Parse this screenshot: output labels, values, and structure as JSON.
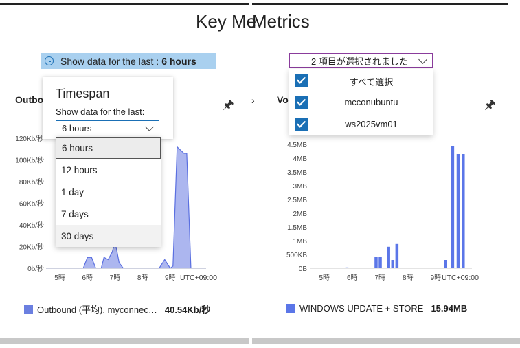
{
  "page_title_left": "Key Me",
  "page_title_right": "Metrics",
  "left": {
    "timebar": {
      "prefix": "Show data for the last :",
      "value": "6 hours"
    },
    "chart_title_partial": "Outbo",
    "popup": {
      "title": "Timespan",
      "label": "Show data for the last:",
      "selected": "6 hours",
      "options": [
        "6 hours",
        "12 hours",
        "1 day",
        "7 days",
        "30 days"
      ]
    },
    "legend": {
      "label": "Outbound (平均), myconnec…",
      "value": "40.54Kb/秒",
      "color": "#6b7fe0"
    }
  },
  "right": {
    "chart_title_partial": "Vo",
    "multiselect": {
      "summary": "2 項目が選択されました",
      "items": [
        {
          "label": "すべて選択",
          "checked": true
        },
        {
          "label": "mcconubuntu",
          "checked": true
        },
        {
          "label": "ws2025vm01",
          "checked": true
        }
      ]
    },
    "legend": {
      "label": "WINDOWS UPDATE + STORE",
      "value": "15.94MB",
      "color": "#5b76e8"
    }
  },
  "chart_data": [
    {
      "type": "area",
      "title": "",
      "y_ticks": [
        "0b/秒",
        "20Kb/秒",
        "40Kb/秒",
        "60Kb/秒",
        "80Kb/秒",
        "100Kb/秒",
        "120Kb/秒"
      ],
      "x_ticks": [
        "5時",
        "6時",
        "7時",
        "8時",
        "9時"
      ],
      "timezone_label": "UTC+09:00",
      "ylim": [
        0,
        120
      ],
      "y_unit": "Kb/秒",
      "x": [
        4.5,
        4.9,
        5.1,
        5.5,
        5.65,
        5.85,
        6.0,
        6.15,
        6.3,
        6.5,
        6.6,
        6.75,
        6.9,
        7.0,
        7.15,
        7.3,
        7.5,
        7.65,
        7.9,
        8.15,
        8.4,
        8.6,
        8.8,
        9.0,
        9.1,
        9.25,
        9.5,
        9.6,
        9.75,
        9.95,
        10.1,
        10.3
      ],
      "series": [
        {
          "values": [
            0,
            0,
            0,
            0,
            0,
            0,
            10,
            10,
            0,
            0,
            10,
            8,
            15,
            25,
            5,
            0,
            0,
            0,
            0,
            0,
            0,
            0,
            8,
            0,
            2,
            112,
            106,
            106,
            0,
            0,
            0,
            0
          ],
          "color": "#9ea9ec"
        }
      ],
      "grid": false
    },
    {
      "type": "bar",
      "title": "",
      "y_ticks": [
        "0B",
        "500KB",
        "1MB",
        "1.5MB",
        "2MB",
        "2.5MB",
        "3MB",
        "3.5MB",
        "4MB",
        "4.5MB"
      ],
      "x_ticks": [
        "5時",
        "6時",
        "7時",
        "8時",
        "9時"
      ],
      "timezone_label": "UTC+09:00",
      "ylim": [
        0,
        4.5
      ],
      "y_unit": "MB",
      "x": [
        5.8,
        6.85,
        7.0,
        7.3,
        7.45,
        7.6,
        8.1,
        8.4,
        9.35,
        9.6,
        9.8,
        9.98
      ],
      "series": [
        {
          "name": "WINDOWS UPDATE + STORE",
          "values": [
            0.03,
            0.4,
            0.4,
            0.78,
            0.3,
            0.88,
            0.02,
            0.02,
            0.3,
            4.45,
            4.15,
            4.15
          ],
          "color": "#5b76e8"
        }
      ],
      "grid": false
    }
  ]
}
